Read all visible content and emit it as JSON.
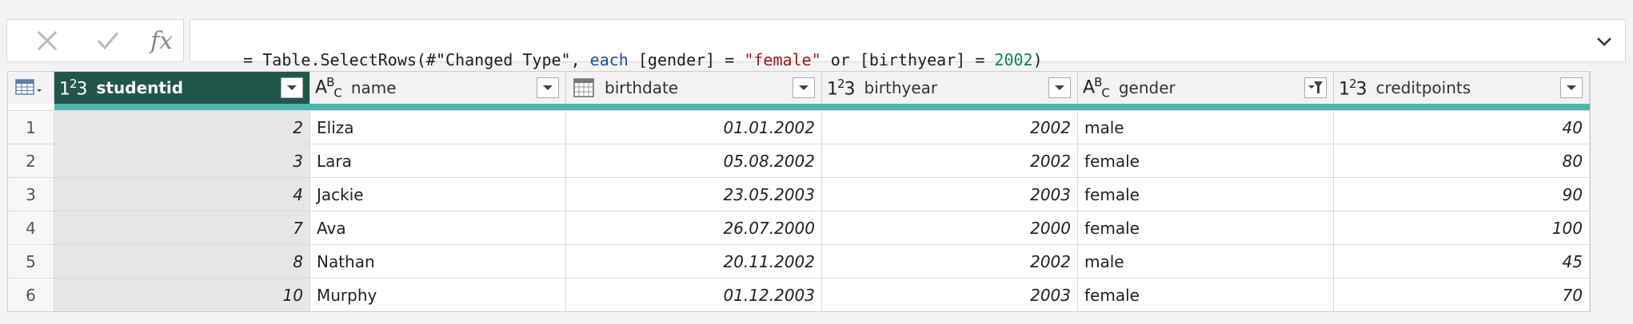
{
  "formula_bar": {
    "cancel_icon": "x-icon",
    "commit_icon": "check-icon",
    "fx_label": "fx",
    "formula_parts": [
      {
        "text": "= Table.SelectRows(#\"Changed Type\", ",
        "kind": "plain"
      },
      {
        "text": "each",
        "kind": "keyword"
      },
      {
        "text": " [gender] = ",
        "kind": "plain"
      },
      {
        "text": "\"female\"",
        "kind": "string"
      },
      {
        "text": " or [birthyear] = ",
        "kind": "plain"
      },
      {
        "text": "2002",
        "kind": "number"
      },
      {
        "text": ")",
        "kind": "plain"
      }
    ],
    "expand_icon": "chevron-down-icon"
  },
  "table": {
    "columns": [
      {
        "label": "studentid",
        "type_icon": "123",
        "selected": true,
        "filtered": false
      },
      {
        "label": "name",
        "type_icon": "ABC",
        "selected": false,
        "filtered": false
      },
      {
        "label": "birthdate",
        "type_icon": "calendar",
        "selected": false,
        "filtered": false
      },
      {
        "label": "birthyear",
        "type_icon": "123",
        "selected": false,
        "filtered": false
      },
      {
        "label": "gender",
        "type_icon": "ABC",
        "selected": false,
        "filtered": true
      },
      {
        "label": "creditpoints",
        "type_icon": "123",
        "selected": false,
        "filtered": false
      }
    ],
    "rows": [
      {
        "index": "1",
        "cells": [
          "2",
          "Eliza",
          "01.01.2002",
          "2002",
          "male",
          "40"
        ]
      },
      {
        "index": "2",
        "cells": [
          "3",
          "Lara",
          "05.08.2002",
          "2002",
          "female",
          "80"
        ]
      },
      {
        "index": "3",
        "cells": [
          "4",
          "Jackie",
          "23.05.2003",
          "2003",
          "female",
          "90"
        ]
      },
      {
        "index": "4",
        "cells": [
          "7",
          "Ava",
          "26.07.2000",
          "2000",
          "female",
          "100"
        ]
      },
      {
        "index": "5",
        "cells": [
          "8",
          "Nathan",
          "20.11.2002",
          "2002",
          "male",
          "45"
        ]
      },
      {
        "index": "6",
        "cells": [
          "10",
          "Murphy",
          "01.12.2003",
          "2003",
          "female",
          "70"
        ]
      }
    ]
  },
  "colors": {
    "selected_header": "#21574a",
    "quality_bar": "#4db6ac",
    "keyword": "#1a4fa0",
    "string": "#a31515",
    "number": "#098658"
  }
}
